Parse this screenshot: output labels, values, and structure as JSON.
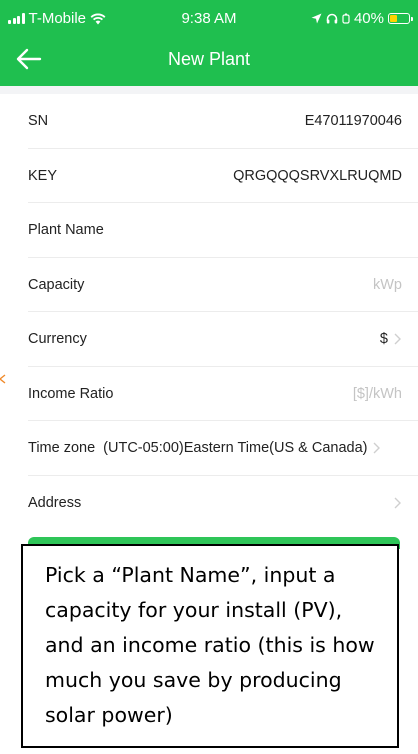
{
  "status_bar": {
    "carrier": "T-Mobile",
    "time": "9:38 AM",
    "battery": "40%",
    "battery_level": 0.4
  },
  "header": {
    "title": "New Plant",
    "back_icon": "arrow-left-icon",
    "background": "#1fbf4f"
  },
  "form": {
    "rows": [
      {
        "label": "SN",
        "value": "E47011970046"
      },
      {
        "label": "KEY",
        "value": "QRGQQQSRVXLRUQMD"
      },
      {
        "label": "Plant Name",
        "value": ""
      },
      {
        "label": "Capacity",
        "placeholder": "kWp"
      },
      {
        "label": "Currency",
        "value": "$"
      },
      {
        "label": "Income Ratio",
        "placeholder": "[$]/kWh"
      },
      {
        "label": "Time zone",
        "value": "(UTC-05:00)Eastern Time(US & Canada)"
      },
      {
        "label": "Address",
        "value": ""
      }
    ]
  },
  "callout": {
    "text": "Pick a “Plant Name”, input a capacity for your install (PV), and an income ratio (this is how much you save by producing solar power)"
  },
  "colors": {
    "accent": "#1fbf4f",
    "button": "#2ec558",
    "placeholder": "#c4c4c4",
    "annotation_tick": "#f08a2b"
  }
}
